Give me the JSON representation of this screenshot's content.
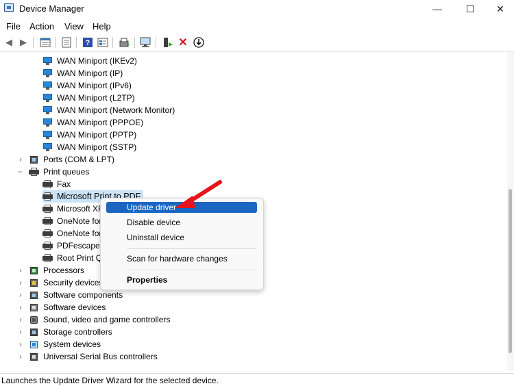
{
  "window": {
    "title": "Device Manager",
    "controls": {
      "minimize": "—",
      "maximize": "☐",
      "close": "✕"
    }
  },
  "menu": [
    "File",
    "Action",
    "View",
    "Help"
  ],
  "toolbar": {
    "icons": [
      "back-icon",
      "forward-icon",
      "show-hidden-icon",
      "properties-icon",
      "help-icon",
      "view-icon",
      "update-driver-icon",
      "scan-hardware-icon",
      "enable-device-icon",
      "uninstall-device-icon",
      "disable-device-icon"
    ]
  },
  "tree": {
    "wan_items": [
      "WAN Miniport (IKEv2)",
      "WAN Miniport (IP)",
      "WAN Miniport (IPv6)",
      "WAN Miniport (L2TP)",
      "WAN Miniport (Network Monitor)",
      "WAN Miniport (PPPOE)",
      "WAN Miniport (PPTP)",
      "WAN Miniport (SSTP)"
    ],
    "ports": "Ports (COM & LPT)",
    "print_queues": "Print queues",
    "printers": [
      "Fax",
      "Microsoft Print to PDF",
      "Microsoft XF",
      "OneNote for",
      "OneNote for",
      "PDFescape D",
      "Root Print Q"
    ],
    "categories": [
      "Processors",
      "Security devices",
      "Software components",
      "Software devices",
      "Sound, video and game controllers",
      "Storage controllers",
      "System devices",
      "Universal Serial Bus controllers"
    ]
  },
  "context_menu": {
    "update_driver": "Update driver",
    "disable_device": "Disable device",
    "uninstall_device": "Uninstall device",
    "scan_hardware": "Scan for hardware changes",
    "properties": "Properties"
  },
  "status": "Launches the Update Driver Wizard for the selected device.",
  "colors": {
    "selection": "#cce4f7",
    "menu_highlight": "#1a66c2",
    "annotation_arrow": "#e8141b"
  }
}
